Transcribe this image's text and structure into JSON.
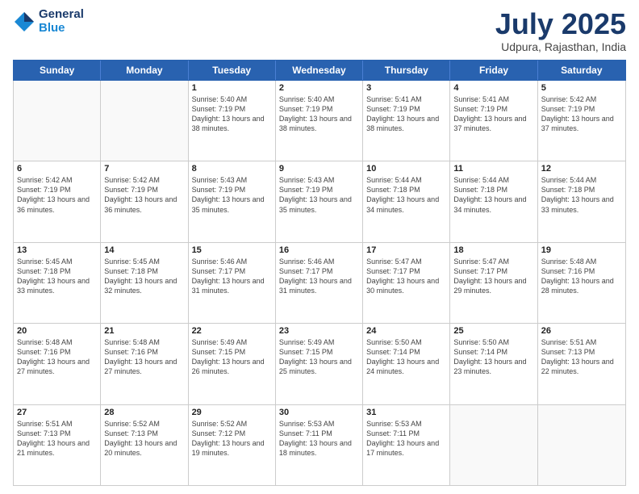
{
  "logo": {
    "general": "General",
    "blue": "Blue"
  },
  "title": {
    "month": "July 2025",
    "location": "Udpura, Rajasthan, India"
  },
  "header_days": [
    "Sunday",
    "Monday",
    "Tuesday",
    "Wednesday",
    "Thursday",
    "Friday",
    "Saturday"
  ],
  "weeks": [
    [
      {
        "day": "",
        "info": ""
      },
      {
        "day": "",
        "info": ""
      },
      {
        "day": "1",
        "info": "Sunrise: 5:40 AM\nSunset: 7:19 PM\nDaylight: 13 hours and 38 minutes."
      },
      {
        "day": "2",
        "info": "Sunrise: 5:40 AM\nSunset: 7:19 PM\nDaylight: 13 hours and 38 minutes."
      },
      {
        "day": "3",
        "info": "Sunrise: 5:41 AM\nSunset: 7:19 PM\nDaylight: 13 hours and 38 minutes."
      },
      {
        "day": "4",
        "info": "Sunrise: 5:41 AM\nSunset: 7:19 PM\nDaylight: 13 hours and 37 minutes."
      },
      {
        "day": "5",
        "info": "Sunrise: 5:42 AM\nSunset: 7:19 PM\nDaylight: 13 hours and 37 minutes."
      }
    ],
    [
      {
        "day": "6",
        "info": "Sunrise: 5:42 AM\nSunset: 7:19 PM\nDaylight: 13 hours and 36 minutes."
      },
      {
        "day": "7",
        "info": "Sunrise: 5:42 AM\nSunset: 7:19 PM\nDaylight: 13 hours and 36 minutes."
      },
      {
        "day": "8",
        "info": "Sunrise: 5:43 AM\nSunset: 7:19 PM\nDaylight: 13 hours and 35 minutes."
      },
      {
        "day": "9",
        "info": "Sunrise: 5:43 AM\nSunset: 7:19 PM\nDaylight: 13 hours and 35 minutes."
      },
      {
        "day": "10",
        "info": "Sunrise: 5:44 AM\nSunset: 7:18 PM\nDaylight: 13 hours and 34 minutes."
      },
      {
        "day": "11",
        "info": "Sunrise: 5:44 AM\nSunset: 7:18 PM\nDaylight: 13 hours and 34 minutes."
      },
      {
        "day": "12",
        "info": "Sunrise: 5:44 AM\nSunset: 7:18 PM\nDaylight: 13 hours and 33 minutes."
      }
    ],
    [
      {
        "day": "13",
        "info": "Sunrise: 5:45 AM\nSunset: 7:18 PM\nDaylight: 13 hours and 33 minutes."
      },
      {
        "day": "14",
        "info": "Sunrise: 5:45 AM\nSunset: 7:18 PM\nDaylight: 13 hours and 32 minutes."
      },
      {
        "day": "15",
        "info": "Sunrise: 5:46 AM\nSunset: 7:17 PM\nDaylight: 13 hours and 31 minutes."
      },
      {
        "day": "16",
        "info": "Sunrise: 5:46 AM\nSunset: 7:17 PM\nDaylight: 13 hours and 31 minutes."
      },
      {
        "day": "17",
        "info": "Sunrise: 5:47 AM\nSunset: 7:17 PM\nDaylight: 13 hours and 30 minutes."
      },
      {
        "day": "18",
        "info": "Sunrise: 5:47 AM\nSunset: 7:17 PM\nDaylight: 13 hours and 29 minutes."
      },
      {
        "day": "19",
        "info": "Sunrise: 5:48 AM\nSunset: 7:16 PM\nDaylight: 13 hours and 28 minutes."
      }
    ],
    [
      {
        "day": "20",
        "info": "Sunrise: 5:48 AM\nSunset: 7:16 PM\nDaylight: 13 hours and 27 minutes."
      },
      {
        "day": "21",
        "info": "Sunrise: 5:48 AM\nSunset: 7:16 PM\nDaylight: 13 hours and 27 minutes."
      },
      {
        "day": "22",
        "info": "Sunrise: 5:49 AM\nSunset: 7:15 PM\nDaylight: 13 hours and 26 minutes."
      },
      {
        "day": "23",
        "info": "Sunrise: 5:49 AM\nSunset: 7:15 PM\nDaylight: 13 hours and 25 minutes."
      },
      {
        "day": "24",
        "info": "Sunrise: 5:50 AM\nSunset: 7:14 PM\nDaylight: 13 hours and 24 minutes."
      },
      {
        "day": "25",
        "info": "Sunrise: 5:50 AM\nSunset: 7:14 PM\nDaylight: 13 hours and 23 minutes."
      },
      {
        "day": "26",
        "info": "Sunrise: 5:51 AM\nSunset: 7:13 PM\nDaylight: 13 hours and 22 minutes."
      }
    ],
    [
      {
        "day": "27",
        "info": "Sunrise: 5:51 AM\nSunset: 7:13 PM\nDaylight: 13 hours and 21 minutes."
      },
      {
        "day": "28",
        "info": "Sunrise: 5:52 AM\nSunset: 7:13 PM\nDaylight: 13 hours and 20 minutes."
      },
      {
        "day": "29",
        "info": "Sunrise: 5:52 AM\nSunset: 7:12 PM\nDaylight: 13 hours and 19 minutes."
      },
      {
        "day": "30",
        "info": "Sunrise: 5:53 AM\nSunset: 7:11 PM\nDaylight: 13 hours and 18 minutes."
      },
      {
        "day": "31",
        "info": "Sunrise: 5:53 AM\nSunset: 7:11 PM\nDaylight: 13 hours and 17 minutes."
      },
      {
        "day": "",
        "info": ""
      },
      {
        "day": "",
        "info": ""
      }
    ]
  ]
}
